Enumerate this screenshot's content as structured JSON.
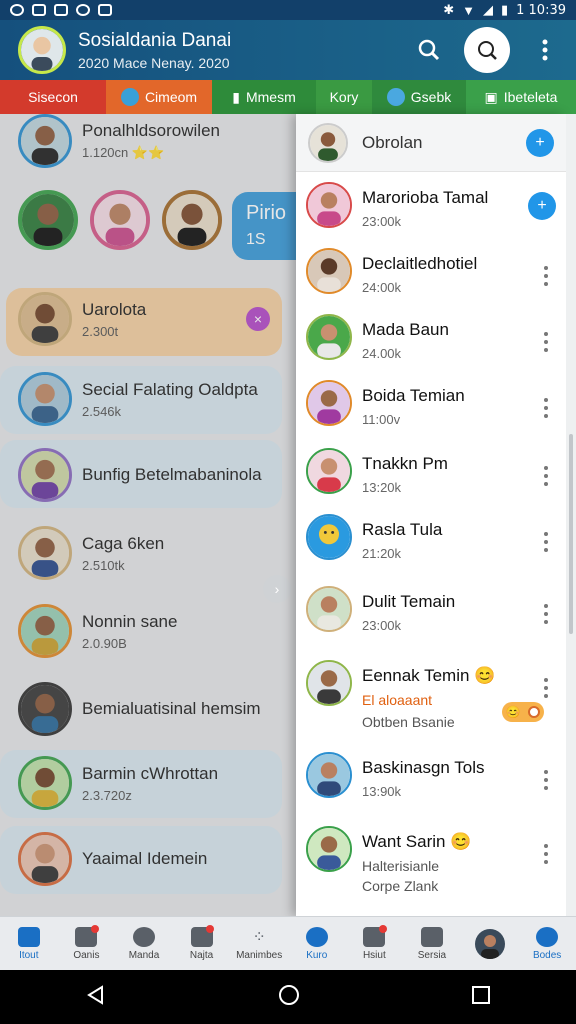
{
  "status_bar": {
    "time": "1 10:39"
  },
  "header": {
    "title": "Sosialdania Danai",
    "subtitle": "2020 Mace Nenay. 2020"
  },
  "tabs": [
    {
      "label": "Sisecon",
      "color": "#d33a2c"
    },
    {
      "label": "Cimeom",
      "color": "#e2672a"
    },
    {
      "label": "Mmesm",
      "color": "#2e8b3a"
    },
    {
      "label": "Kory",
      "color": "#3a9a42"
    },
    {
      "label": "Gsebk",
      "color": "#2f8a3d"
    },
    {
      "label": "Ibeteleta",
      "color": "#3aa04a"
    }
  ],
  "left_list": {
    "rows": [
      {
        "name": "Ponalhldsorowilen",
        "sub": "1.120cn ⭐⭐"
      },
      {
        "name": "Uarolota",
        "sub": "2.300t"
      },
      {
        "name": "Secial Falating Oaldpta",
        "sub": "2.546k"
      },
      {
        "name": "Bunfig Betelmabaninola",
        "sub": ""
      },
      {
        "name": "Caga 6ken",
        "sub": "2.510tk"
      },
      {
        "name": "Nonnin sane",
        "sub": "2.0.90B"
      },
      {
        "name": "Bemialuatisinal hemsim",
        "sub": ""
      },
      {
        "name": "Barmin cWhrottan",
        "sub": "2.3.720z"
      },
      {
        "name": "Yaaimal Idemein",
        "sub": ""
      }
    ],
    "story_bubble": {
      "title": "Pirio",
      "sub": "1S"
    }
  },
  "drawer": {
    "title": "Obrolan",
    "chats": [
      {
        "name": "Marorioba Tamal",
        "time": "23:00k"
      },
      {
        "name": "Declaitledhotiel",
        "time": "24:00k"
      },
      {
        "name": "Mada Baun",
        "time": "24.00k"
      },
      {
        "name": "Boida Temian",
        "time": "11:00v"
      },
      {
        "name": "Tnakkn Pm",
        "time": "13:20k"
      },
      {
        "name": "Rasla Tula",
        "time": "21:20k"
      },
      {
        "name": "Dulit Temain",
        "time": "23:00k"
      },
      {
        "name": "Eennak Temin 😊",
        "highlight": "El aloaaant",
        "line": "Obtben Bsanie"
      },
      {
        "name": "Baskinasgn Tols",
        "time": "13:90k"
      },
      {
        "name": "Want Sarin 😊",
        "line": "Halterisianle",
        "line2": "Corpe Zlank"
      }
    ]
  },
  "bottom_nav": [
    {
      "label": "Itout"
    },
    {
      "label": "Oanis"
    },
    {
      "label": "Manda"
    },
    {
      "label": "Najta"
    },
    {
      "label": "Manimbes"
    },
    {
      "label": "Kuro"
    },
    {
      "label": "Hsiut"
    },
    {
      "label": "Sersia"
    },
    {
      "label": ""
    },
    {
      "label": "Bodes"
    }
  ]
}
